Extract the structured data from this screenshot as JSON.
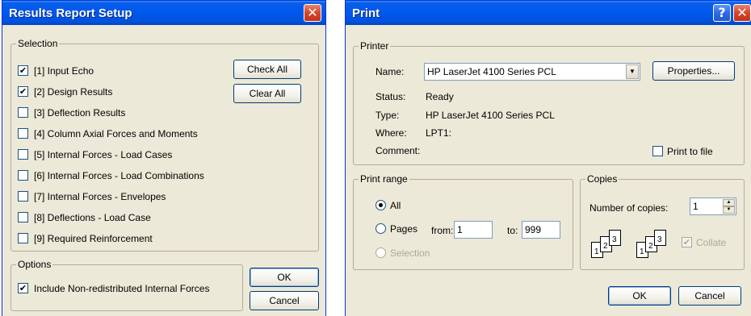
{
  "results_dialog": {
    "title": "Results Report Setup",
    "selection_label": "Selection",
    "items": [
      {
        "label": "[1] Input Echo",
        "checked": true
      },
      {
        "label": "[2] Design Results",
        "checked": true
      },
      {
        "label": "[3] Deflection Results",
        "checked": false
      },
      {
        "label": "[4] Column Axial Forces and Moments",
        "checked": false
      },
      {
        "label": "[5] Internal Forces - Load Cases",
        "checked": false
      },
      {
        "label": "[6] Internal Forces - Load Combinations",
        "checked": false
      },
      {
        "label": "[7] Internal Forces - Envelopes",
        "checked": false
      },
      {
        "label": "[8] Deflections - Load Case",
        "checked": false
      },
      {
        "label": "[9] Required Reinforcement",
        "checked": false
      }
    ],
    "check_all_label": "Check All",
    "clear_all_label": "Clear All",
    "options_label": "Options",
    "option_item_label": "Include Non-redistributed Internal Forces",
    "option_item_checked": true,
    "ok_label": "OK",
    "cancel_label": "Cancel"
  },
  "print_dialog": {
    "title": "Print",
    "printer_label": "Printer",
    "name_label": "Name:",
    "name_value": "HP LaserJet 4100 Series PCL",
    "properties_label": "Properties...",
    "status_label": "Status:",
    "status_value": "Ready",
    "type_label": "Type:",
    "type_value": "HP LaserJet 4100 Series PCL",
    "where_label": "Where:",
    "where_value": "LPT1:",
    "comment_label": "Comment:",
    "print_to_file_label": "Print to file",
    "print_range_label": "Print range",
    "all_label": "All",
    "pages_label": "Pages",
    "from_label": "from:",
    "from_value": "1",
    "to_label": "to:",
    "to_value": "999",
    "selection_label": "Selection",
    "copies_label": "Copies",
    "number_of_copies_label": "Number of copies:",
    "copies_value": "1",
    "collate_label": "Collate",
    "collate_page_numbers": [
      "1",
      "2",
      "3",
      "1",
      "2",
      "3"
    ],
    "ok_label": "OK",
    "cancel_label": "Cancel"
  }
}
